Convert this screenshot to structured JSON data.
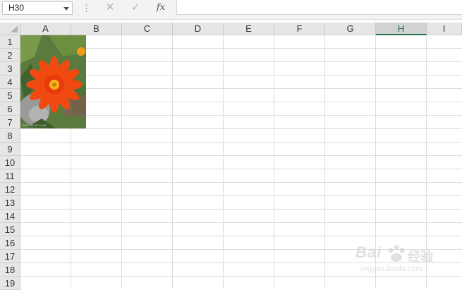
{
  "formula_bar": {
    "name_box_value": "H30",
    "cancel_glyph": "✕",
    "enter_glyph": "✓",
    "fx_label": "fx",
    "formula_value": ""
  },
  "columns": [
    "A",
    "B",
    "C",
    "D",
    "E",
    "F",
    "G",
    "H",
    "I"
  ],
  "selected_column": "H",
  "rows": [
    "1",
    "2",
    "3",
    "4",
    "5",
    "6",
    "7",
    "8",
    "9",
    "10",
    "11",
    "12",
    "13",
    "14",
    "15",
    "16",
    "17",
    "18",
    "19"
  ],
  "picture": {
    "subject": "orange flower photo",
    "caption": "2017.08.12 14:01"
  },
  "watermark": {
    "logo": "Bai",
    "cn": "经验",
    "url": "jingyan.baidu.com"
  }
}
